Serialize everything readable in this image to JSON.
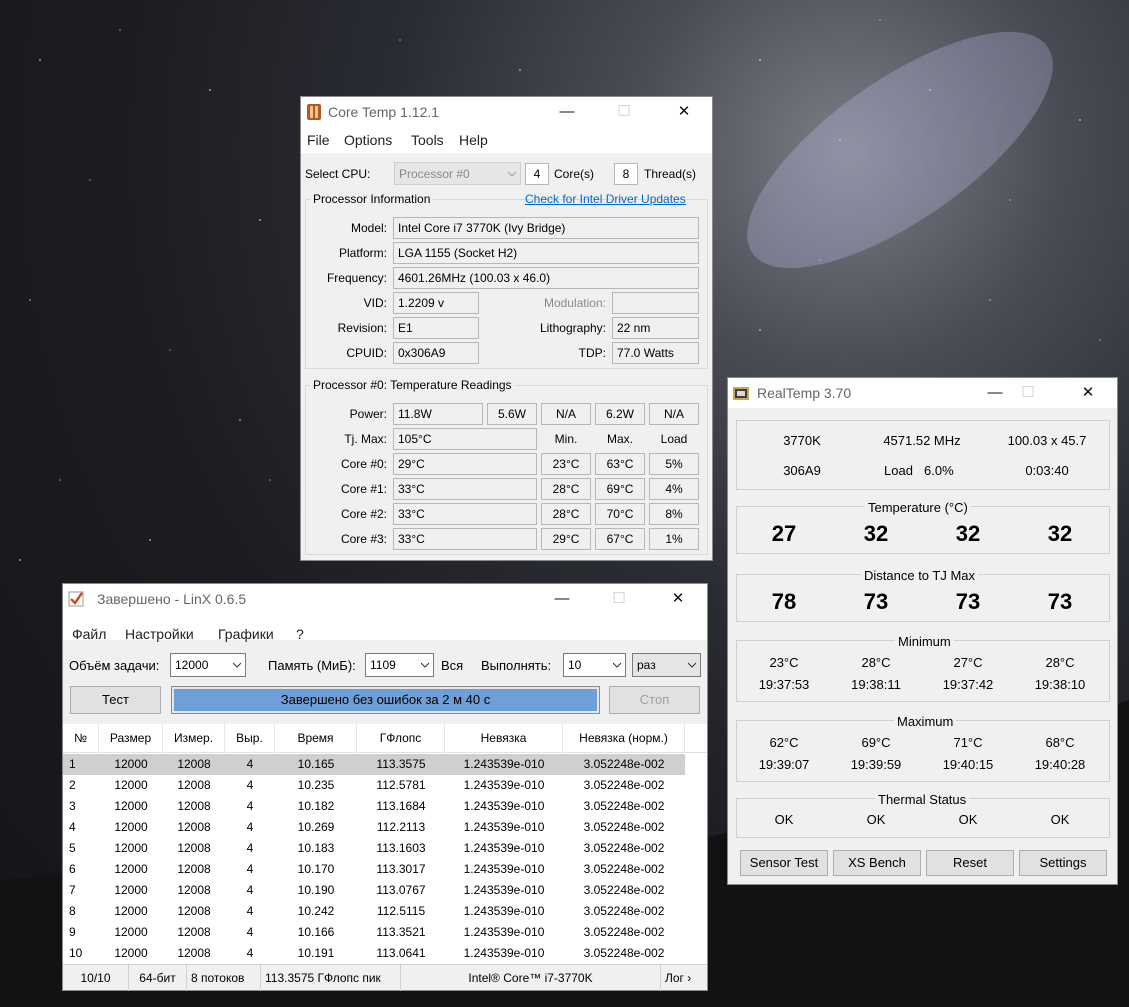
{
  "coretemp": {
    "title": "Core Temp 1.12.1",
    "controls": {
      "minimize": "—",
      "maximize": "☐",
      "close": "✕"
    },
    "menu": [
      "File",
      "Options",
      "Tools",
      "Help"
    ],
    "select_cpu_label": "Select CPU:",
    "selected_cpu": "Processor #0",
    "cores_value": "4",
    "cores_label": "Core(s)",
    "threads_value": "8",
    "threads_label": "Thread(s)",
    "info_title": "Processor Information",
    "driver_link": "Check for Intel Driver Updates",
    "model_label": "Model:",
    "model": "Intel Core i7 3770K (Ivy Bridge)",
    "platform_label": "Platform:",
    "platform": "LGA 1155 (Socket H2)",
    "frequency_label": "Frequency:",
    "frequency": "4601.26MHz (100.03 x 46.0)",
    "vid_label": "VID:",
    "vid": "1.2209 v",
    "modulation_label": "Modulation:",
    "modulation": "",
    "revision_label": "Revision:",
    "revision": "E1",
    "lithography_label": "Lithography:",
    "lithography": "22 nm",
    "cpuid_label": "CPUID:",
    "cpuid": "0x306A9",
    "tdp_label": "TDP:",
    "tdp": "77.0 Watts",
    "temps_title": "Processor #0: Temperature Readings",
    "power_label": "Power:",
    "power": [
      "11.8W",
      "5.6W",
      "N/A",
      "6.2W",
      "N/A"
    ],
    "tjmax_label": "Tj. Max:",
    "tjmax": "105°C",
    "col_min": "Min.",
    "col_max": "Max.",
    "col_load": "Load",
    "cores": [
      {
        "label": "Core #0:",
        "temp": "29°C",
        "min": "23°C",
        "max": "63°C",
        "load": "5%"
      },
      {
        "label": "Core #1:",
        "temp": "33°C",
        "min": "28°C",
        "max": "69°C",
        "load": "4%"
      },
      {
        "label": "Core #2:",
        "temp": "33°C",
        "min": "28°C",
        "max": "70°C",
        "load": "8%"
      },
      {
        "label": "Core #3:",
        "temp": "33°C",
        "min": "29°C",
        "max": "67°C",
        "load": "1%"
      }
    ]
  },
  "linx": {
    "title": "Завершено - LinX 0.6.5",
    "controls": {
      "minimize": "—",
      "maximize": "☐",
      "close": "✕"
    },
    "menu": [
      "Файл",
      "Настройки",
      "Графики",
      "?"
    ],
    "task_label": "Объём задачи:",
    "task_value": "12000",
    "memory_label": "Память (МиБ):",
    "memory_value": "1109",
    "all_label": "Вся",
    "run_label": "Выполнять:",
    "run_value": "10",
    "run_unit": "раз",
    "test_button": "Тест",
    "progress_text": "Завершено без ошибок за 2 м 40 с",
    "progress": 1.0,
    "stop_button": "Стоп",
    "columns": [
      "№",
      "Размер",
      "Измер.",
      "Выр.",
      "Время",
      "ГФлопс",
      "Невязка",
      "Невязка (норм.)"
    ],
    "rows": [
      [
        "1",
        "12000",
        "12008",
        "4",
        "10.165",
        "113.3575",
        "1.243539e-010",
        "3.052248e-002"
      ],
      [
        "2",
        "12000",
        "12008",
        "4",
        "10.235",
        "112.5781",
        "1.243539e-010",
        "3.052248e-002"
      ],
      [
        "3",
        "12000",
        "12008",
        "4",
        "10.182",
        "113.1684",
        "1.243539e-010",
        "3.052248e-002"
      ],
      [
        "4",
        "12000",
        "12008",
        "4",
        "10.269",
        "112.2113",
        "1.243539e-010",
        "3.052248e-002"
      ],
      [
        "5",
        "12000",
        "12008",
        "4",
        "10.183",
        "113.1603",
        "1.243539e-010",
        "3.052248e-002"
      ],
      [
        "6",
        "12000",
        "12008",
        "4",
        "10.170",
        "113.3017",
        "1.243539e-010",
        "3.052248e-002"
      ],
      [
        "7",
        "12000",
        "12008",
        "4",
        "10.190",
        "113.0767",
        "1.243539e-010",
        "3.052248e-002"
      ],
      [
        "8",
        "12000",
        "12008",
        "4",
        "10.242",
        "112.5115",
        "1.243539e-010",
        "3.052248e-002"
      ],
      [
        "9",
        "12000",
        "12008",
        "4",
        "10.166",
        "113.3521",
        "1.243539e-010",
        "3.052248e-002"
      ],
      [
        "10",
        "12000",
        "12008",
        "4",
        "10.191",
        "113.0641",
        "1.243539e-010",
        "3.052248e-002"
      ]
    ],
    "status": [
      "10/10",
      "64-бит",
      "8 потоков",
      "113.3575 ГФлопс пик",
      "Intel® Core™ i7-3770K",
      "Лог ›"
    ]
  },
  "realtemp": {
    "title": "RealTemp 3.70",
    "controls": {
      "minimize": "—",
      "maximize": "☐",
      "close": "✕"
    },
    "cpu": "3770K",
    "freq": "4571.52 MHz",
    "mult": "100.03 x 45.7",
    "cpuid": "306A9",
    "load_label": "Load",
    "load": "6.0%",
    "uptime": "0:03:40",
    "temperature_title": "Temperature (°C)",
    "temperatures": [
      "27",
      "32",
      "32",
      "32"
    ],
    "distance_title": "Distance to TJ Max",
    "distances": [
      "78",
      "73",
      "73",
      "73"
    ],
    "minimum_title": "Minimum",
    "minimum": [
      {
        "temp": "23°C",
        "time": "19:37:53"
      },
      {
        "temp": "28°C",
        "time": "19:38:11"
      },
      {
        "temp": "27°C",
        "time": "19:37:42"
      },
      {
        "temp": "28°C",
        "time": "19:38:10"
      }
    ],
    "maximum_title": "Maximum",
    "maximum": [
      {
        "temp": "62°C",
        "time": "19:39:07"
      },
      {
        "temp": "69°C",
        "time": "19:39:59"
      },
      {
        "temp": "71°C",
        "time": "19:40:15"
      },
      {
        "temp": "68°C",
        "time": "19:40:28"
      }
    ],
    "thermal_title": "Thermal Status",
    "thermal": [
      "OK",
      "OK",
      "OK",
      "OK"
    ],
    "buttons": [
      "Sensor Test",
      "XS Bench",
      "Reset",
      "Settings"
    ]
  }
}
